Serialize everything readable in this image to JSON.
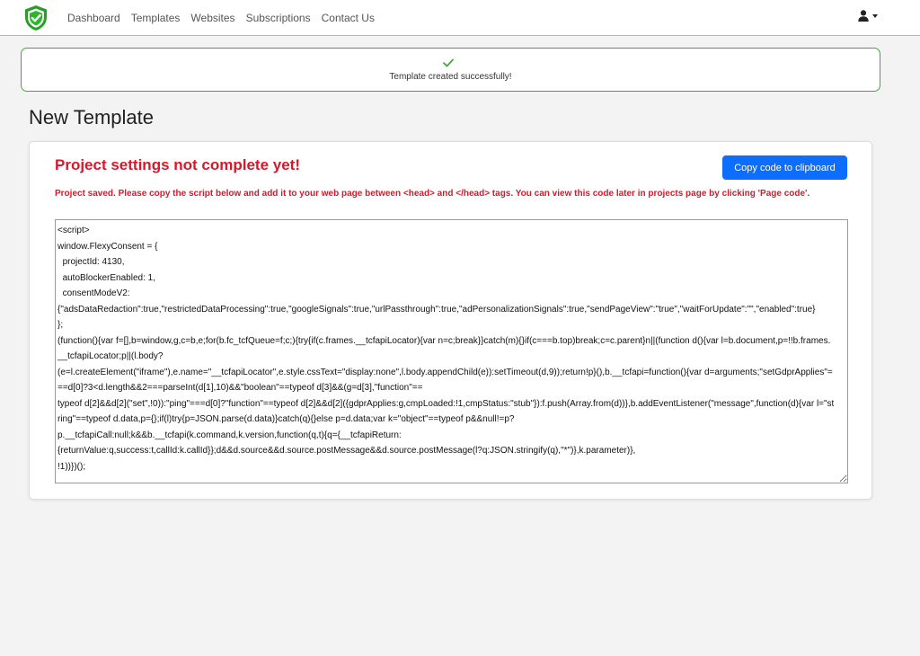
{
  "navbar": {
    "links": [
      "Dashboard",
      "Templates",
      "Websites",
      "Subscriptions",
      "Contact Us"
    ]
  },
  "alert": {
    "message": "Template created successfully!"
  },
  "page": {
    "title": "New Template"
  },
  "card": {
    "heading": "Project settings not complete yet!",
    "copy_button": "Copy code to clipboard",
    "instructions": "Project saved. Please copy the script below and add it to your web page between <head> and </head> tags. You can view this code later in projects page by clicking 'Page code'.",
    "code": "<script>\nwindow.FlexyConsent = {\n  projectId: 4130,\n  autoBlockerEnabled: 1,\n  consentModeV2:\n{\"adsDataRedaction\":true,\"restrictedDataProcessing\":true,\"googleSignals\":true,\"urlPassthrough\":true,\"adPersonalizationSignals\":true,\"sendPageView\":\"true\",\"waitForUpdate\":\"\",\"enabled\":true}\n};\n(function(){var f=[],b=window,g,c=b,e;for(b.fc_tcfQueue=f;c;){try{if(c.frames.__tcfapiLocator){var n=c;break}}catch(m){}if(c===b.top)break;c=c.parent}n||(function d(){var l=b.document,p=!!b.frames.__tcfapiLocator;p||(l.body?\n(e=l.createElement(\"iframe\"),e.name=\"__tcfapiLocator\",e.style.cssText=\"display:none\",l.body.appendChild(e)):setTimeout(d,9));return!p}(),b.__tcfapi=function(){var d=arguments;\"setGdprApplies\"===d[0]?3<d.length&&2===parseInt(d[1],10)&&\"boolean\"==typeof d[3]&&(g=d[3],\"function\"==\ntypeof d[2]&&d[2](\"set\",!0)):\"ping\"===d[0]?\"function\"==typeof d[2]&&d[2]({gdprApplies:g,cmpLoaded:!1,cmpStatus:\"stub\"}):f.push(Array.from(d))},b.addEventListener(\"message\",function(d){var l=\"string\"==typeof d.data,p={};if(l)try{p=JSON.parse(d.data)}catch(q){}else p=d.data;var k=\"object\"==typeof p&&null!=p?\np.__tcfapiCall:null;k&&b.__tcfapi(k.command,k.version,function(q,t){q={__tcfapiReturn:\n{returnValue:q,success:t,callId:k.callId}};d&&d.source&&d.source.postMessage&&d.source.postMessage(l?q:JSON.stringify(q),\"*\")},k.parameter)},\n!1))})();"
  },
  "colors": {
    "accent": "#0d6efd",
    "error": "#d8182a",
    "success": "#3cab3c",
    "shield": "#23a123"
  },
  "icons": [
    "shield-check-logo-icon",
    "user-icon",
    "chevron-down-icon",
    "check-icon"
  ]
}
